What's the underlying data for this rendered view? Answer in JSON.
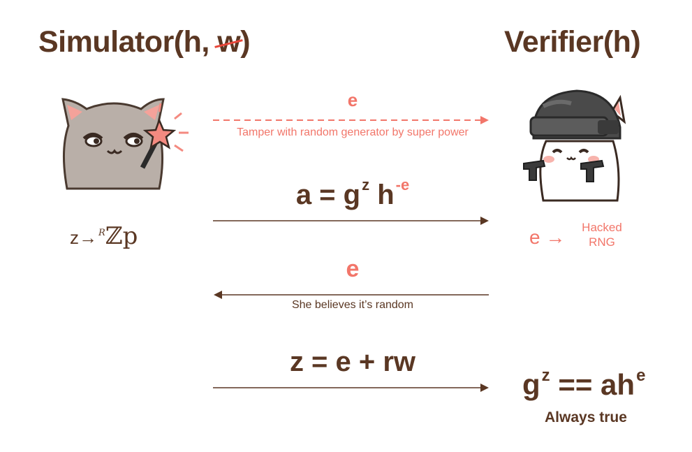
{
  "simulator": {
    "title_prefix": "Simulator(h, ",
    "struck": "w",
    "title_suffix": ")",
    "sample": {
      "lhs": "z",
      "arrow": "→",
      "r": "R",
      "set": "ℤp"
    }
  },
  "verifier": {
    "title": "Verifier(h)",
    "hacked": {
      "e": "e",
      "arrow": "→",
      "label_line1": "Hacked",
      "label_line2": "RNG"
    },
    "check": {
      "g": "g",
      "z": "z",
      "eq": " == ah",
      "e": "e"
    },
    "always": "Always true"
  },
  "messages": {
    "e_top": "e",
    "tamper": "Tamper with random generator by super power",
    "commit": {
      "lhs": "a = g",
      "z": "z",
      "h": " h",
      "minus_e": "-e"
    },
    "e_mid": "e",
    "believes": "She believes it’s random",
    "response": "z = e + rw"
  },
  "colors": {
    "brown": "#5a3723",
    "salmon": "#f2766a",
    "strike": "#e8473a",
    "cat_gray": "#b9afa8",
    "helmet": "#4a4a4a"
  },
  "icons": [
    "cat-with-magic-wand-icon",
    "cat-soldier-with-guns-icon"
  ]
}
